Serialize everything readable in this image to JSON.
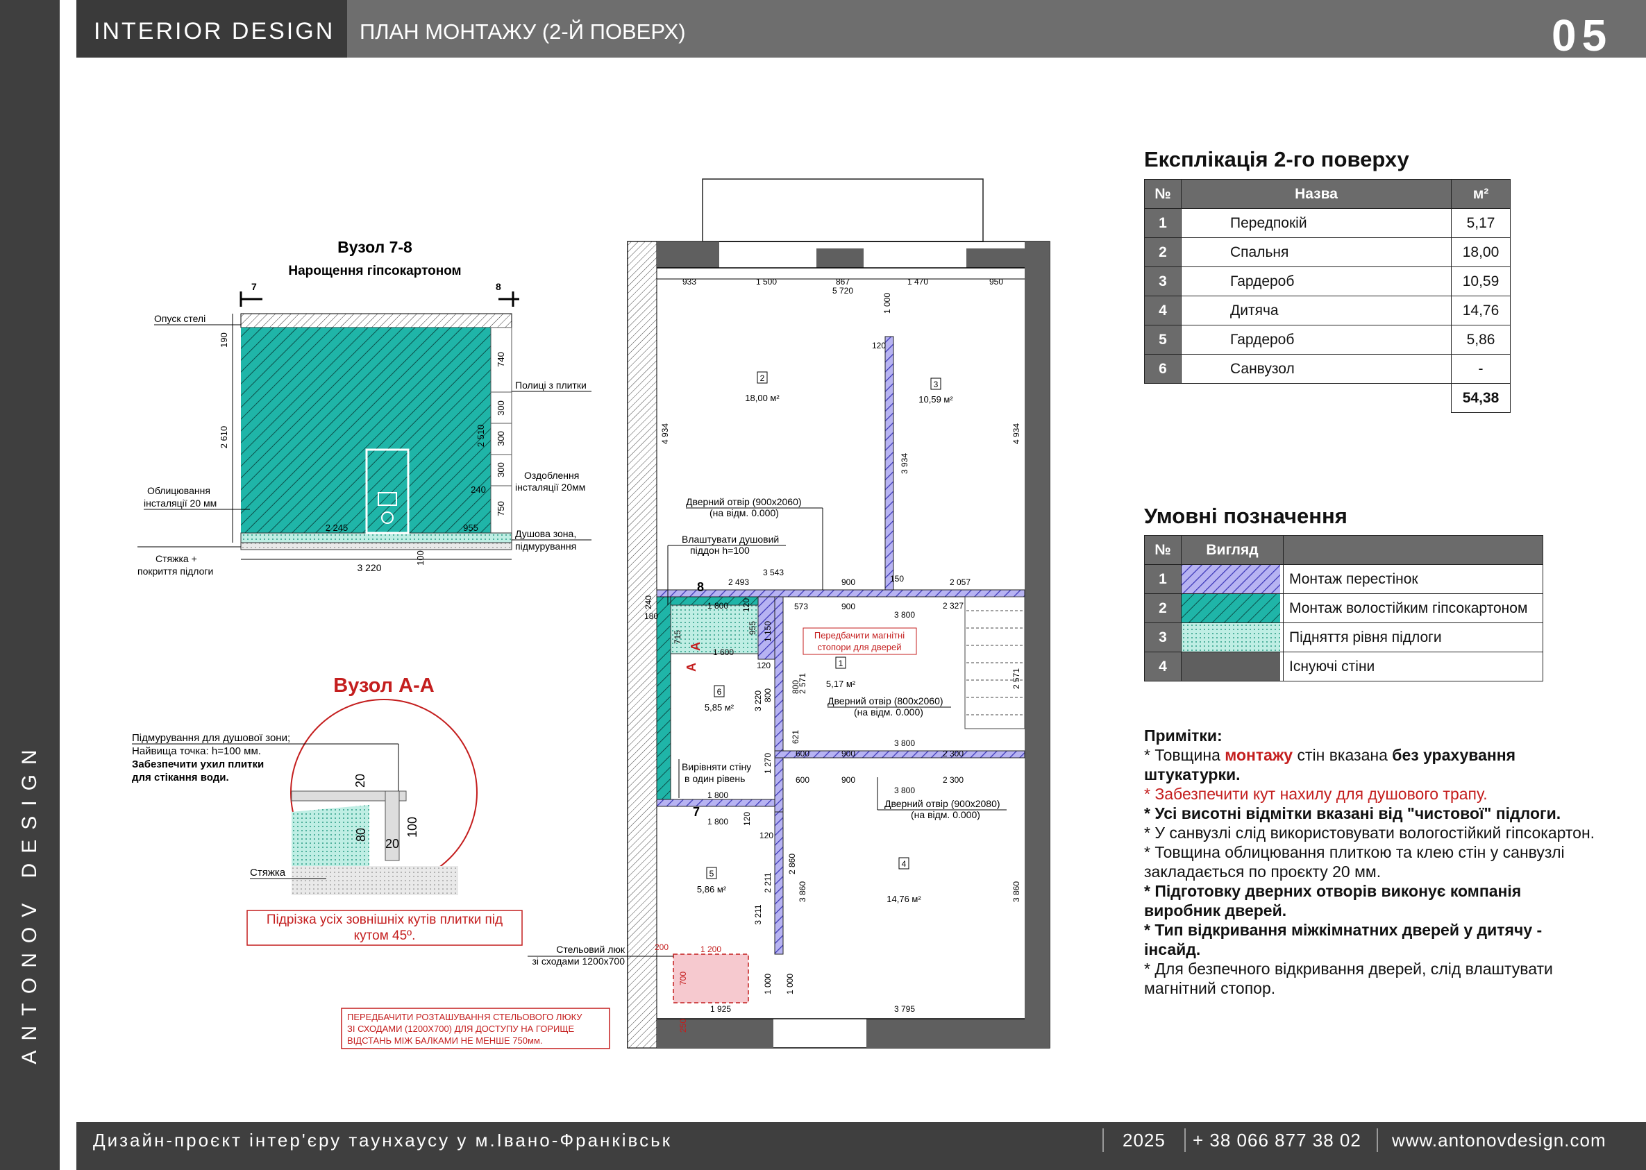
{
  "header": {
    "brand": "INTERIOR DESIGN",
    "sheet_title": "ПЛАН МОНТАЖУ (2-Й ПОВЕРХ)",
    "page_number": "05"
  },
  "sidebar": {
    "brand": "ANTONOV DESIGN"
  },
  "footer": {
    "project": "Дизайн-проєкт інтер'єру таунхаусу у м.Івано-Франківськ",
    "year": "2025",
    "phone": "+ 38 066 877 38 02",
    "website": "www.antonovdesign.com"
  },
  "explication": {
    "title": "Експлікація 2-го поверху",
    "headers": [
      "№",
      "Назва",
      "м²"
    ],
    "rows": [
      {
        "n": "1",
        "name": "Передпокій",
        "area": "5,17"
      },
      {
        "n": "2",
        "name": "Спальня",
        "area": "18,00"
      },
      {
        "n": "3",
        "name": "Гардероб",
        "area": "10,59"
      },
      {
        "n": "4",
        "name": "Дитяча",
        "area": "14,76"
      },
      {
        "n": "5",
        "name": "Гардероб",
        "area": "5,86"
      },
      {
        "n": "6",
        "name": "Санвузол",
        "area": "-"
      }
    ],
    "total": "54,38"
  },
  "legend": {
    "title": "Умовні позначення",
    "headers": [
      "№",
      "Вигляд",
      ""
    ],
    "rows": [
      {
        "n": "1",
        "label": "Монтаж перестінок",
        "swatch": "partition"
      },
      {
        "n": "2",
        "label": "Монтаж волостійким гіпсокартоном",
        "swatch": "gypsum"
      },
      {
        "n": "3",
        "label": "Підняття рівня підлоги",
        "swatch": "floor"
      },
      {
        "n": "4",
        "label": "Існуючі стіни",
        "swatch": "existing"
      }
    ]
  },
  "notes": {
    "title": "Примітки:",
    "n1_a": "* Товщина ",
    "n1_b": "монтажу",
    "n1_c": " стін вказана ",
    "n1_d": "без урахування штукатурки.",
    "n2": "* Забезпечити кут нахилу для душового трапу.",
    "n3": "* Усі висотні відмітки вказані від \"чистової\" підлоги.",
    "n4": "* У санвузлі слід використовувати вологостійкий гіпсокартон.",
    "n5": "* Товщина облицювання плиткою та клею стін у санвузлі закладається по проєкту 20 мм.",
    "n6": "* Підготовку дверних отворів виконує компанія виробник дверей.",
    "n7": "* Тип відкривання міжкімнатних дверей у дитячу - інсайд.",
    "n8": "* Для безпечного відкривання дверей, слід влаштувати магнітний стопор."
  },
  "node78": {
    "title": "Вузол 7-8",
    "subtitle": "Нарощення гіпсокартоном",
    "mark_left": "7",
    "mark_right": "8",
    "l_ceiling": "Опуск стелі",
    "l_cladding_1": "Облицювання",
    "l_cladding_2": "інсталяції 20 мм",
    "l_screed_1": "Стяжка +",
    "l_screed_2": "покриття підлоги",
    "l_shelves": "Полиці з плитки",
    "l_finish_1": "Оздоблення",
    "l_finish_2": "інсталяції 20мм",
    "l_shower_1": "Душова зона,",
    "l_shower_2": "підмурування",
    "d190": "190",
    "d2610": "2 610",
    "d740": "740",
    "d300a": "300",
    "d300b": "300",
    "d300c": "300",
    "d750": "750",
    "d2510": "2 510",
    "d240": "240",
    "d2245": "2 245",
    "d955": "955",
    "d100": "100",
    "d3220": "3 220"
  },
  "nodeAA": {
    "title": "Вузол А-А",
    "l1": "Підмурування для душової зони;",
    "l2": "Найвища точка: h=100 мм.",
    "l3": "Забезпечити ухил плитки",
    "l4": "для стікання води.",
    "l_screed": "Стяжка",
    "d20a": "20",
    "d100": "100",
    "d80": "80",
    "d20b": "20",
    "box_1": "Підрізка усіх зовнішніх кутів плитки під",
    "box_2": "кутом 45º."
  },
  "plan": {
    "dims_top": [
      "933",
      "1 500",
      "867",
      "1 470",
      "950"
    ],
    "dim_total": "5 720",
    "d1000a": "1 000",
    "d120a": "120",
    "d4934l": "4 934",
    "d4934r": "4 934",
    "d3934": "3 934",
    "room2_num": "2",
    "room2_area": "18,00 м²",
    "room3_num": "3",
    "room3_area": "10,59 м²",
    "room1_num": "1",
    "room1_area": "5,17 м²",
    "room6_num": "6",
    "room6_area": "5,85 м²",
    "room5_num": "5",
    "room5_area": "5,86 м²",
    "room4_num": "4",
    "room4_area": "14,76 м²",
    "door1_a": "Дверний отвір (900x2060)",
    "door1_b": "(на відм. 0.000)",
    "tray_a": "Влаштувати душовий",
    "tray_b": "піддон h=100",
    "magnet_a": "Передбачити магнітні",
    "magnet_b": "стопори для дверей",
    "door2_a": "Дверний отвір (800x2060)",
    "door2_b": "(на відм. 0.000)",
    "door3_a": "Дверний отвір (900x2080)",
    "door3_b": "(на відм. 0.000)",
    "align_a": "Вирівняти стіну",
    "align_b": "в один рівень",
    "hatch_a": "Стельовий люк",
    "hatch_b": "зі сходами 1200x700",
    "warn_1": "ПЕРЕДБАЧИТИ РОЗТАШУВАННЯ СТЕЛЬОВОГО ЛЮКУ",
    "warn_2": "ЗІ СХОДАМИ (1200Х700) ДЛЯ ДОСТУПУ НА ГОРИЩЕ",
    "warn_3": "ВІДСТАНЬ МІЖ БАЛКАМИ НЕ МЕНШЕ 750мм.",
    "d3543": "3 543",
    "d2493": "2 493",
    "d900a": "900",
    "d150": "150",
    "d2057": "2 057",
    "d1800a": "1 800",
    "d1600": "1 600",
    "d3800a": "3 800",
    "d2327": "2 327",
    "d573": "573",
    "d900b": "900",
    "d240": "240",
    "d180": "180",
    "d715": "715",
    "d955": "955",
    "d1150": "1 150",
    "d3220": "3 220",
    "d800a": "800",
    "d800b": "800",
    "d2571a": "2 571",
    "d2571b": "2 571",
    "d120b": "120",
    "d120c": "120",
    "d120d": "120",
    "d120e": "120",
    "d600a": "600",
    "d900c": "900",
    "d2300a": "2 300",
    "d3800b": "3 800",
    "d600b": "600",
    "d900d": "900",
    "d2300b": "2 300",
    "d3800c": "3 800",
    "d621": "621",
    "d1270": "1 270",
    "d1800b": "1 800",
    "d1800c": "1 800",
    "d2860": "2 860",
    "d3860l": "3 860",
    "d3860r": "3 860",
    "d3211": "3 211",
    "d2211": "2 211",
    "d1000b": "1 000",
    "d1000c": "1 000",
    "d1925": "1 925",
    "d3795": "3 795",
    "d200": "200",
    "d1200": "1 200",
    "d700": "700",
    "d250": "250",
    "sec_8": "8",
    "sec_7": "7",
    "sec_a1": "А",
    "sec_a2": "А"
  }
}
